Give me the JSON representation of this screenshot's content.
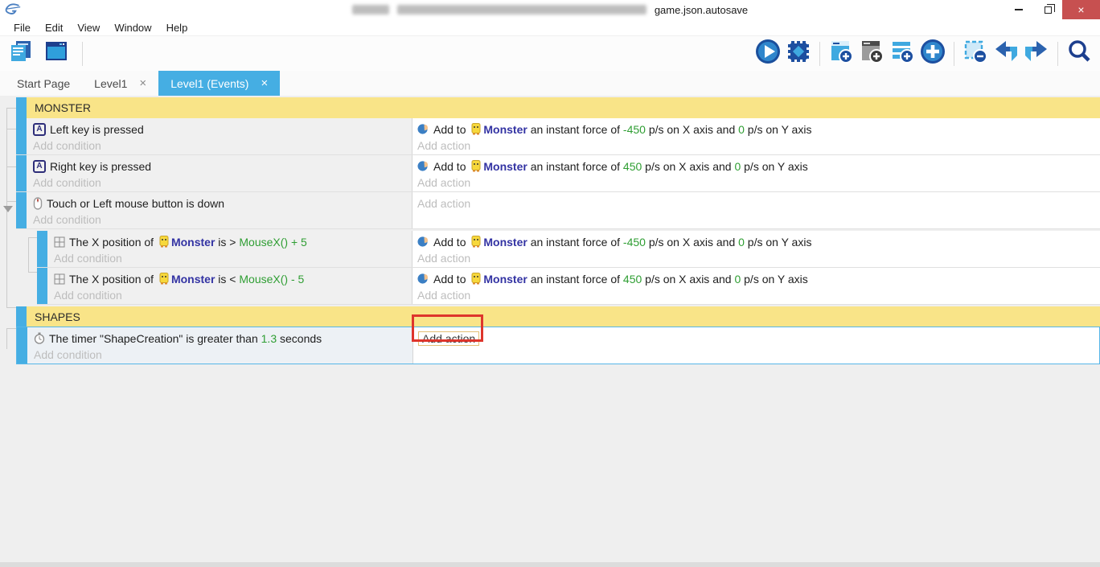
{
  "titlebar": {
    "title_tail": "game.json.autosave",
    "controls": {
      "minimize": "minimize",
      "restore": "restore",
      "close": "×"
    }
  },
  "menubar": {
    "items": [
      "File",
      "Edit",
      "View",
      "Window",
      "Help"
    ]
  },
  "toolbar": {
    "left_icons": [
      "project-manager",
      "scene-editor-window"
    ],
    "right_icons": [
      "play",
      "debug",
      "add-event",
      "add-subevent",
      "add-comment",
      "add-new",
      "remove-selection",
      "undo",
      "redo",
      "search"
    ]
  },
  "tabs": {
    "close_glyph": "×",
    "items": [
      {
        "label": "Start Page"
      },
      {
        "label": "Level1"
      },
      {
        "label": "Level1 (Events)"
      }
    ]
  },
  "sheet": {
    "placeholders": {
      "condition": "Add condition",
      "action": "Add action"
    },
    "key_icon_letter": "A",
    "groups": [
      {
        "label": "MONSTER"
      },
      {
        "label": "SHAPES"
      }
    ],
    "rows": {
      "r1": {
        "cond": {
          "icon": "keyboard-key-icon",
          "text": "Left key is pressed"
        },
        "act": {
          "icon": "force-icon",
          "pre": "Add to ",
          "obj_icon": "monster-object-icon",
          "obj": "Monster",
          "t1": " an instant force of ",
          "v1": "-450",
          "t2": " p/s on X axis and ",
          "v2": "0",
          "t3": " p/s on Y axis"
        }
      },
      "r2": {
        "cond": {
          "icon": "keyboard-key-icon",
          "text": "Right key is pressed"
        },
        "act": {
          "icon": "force-icon",
          "pre": "Add to ",
          "obj_icon": "monster-object-icon",
          "obj": "Monster",
          "t1": " an instant force of ",
          "v1": "450",
          "t2": " p/s on X axis and ",
          "v2": "0",
          "t3": " p/s on Y axis"
        }
      },
      "r3": {
        "cond": {
          "icon": "mouse-icon",
          "text": "Touch or Left mouse button is down"
        }
      },
      "s1": {
        "cond": {
          "icon": "x-position-icon",
          "pre": "The X position of ",
          "obj_icon": "monster-object-icon",
          "obj": "Monster",
          "mid": " is ",
          "op": "> ",
          "expr": "MouseX() + 5"
        },
        "act": {
          "icon": "force-icon",
          "pre": "Add to ",
          "obj_icon": "monster-object-icon",
          "obj": "Monster",
          "t1": " an instant force of ",
          "v1": "-450",
          "t2": " p/s on X axis and ",
          "v2": "0",
          "t3": " p/s on Y axis"
        }
      },
      "s2": {
        "cond": {
          "icon": "x-position-icon",
          "pre": "The X position of ",
          "obj_icon": "monster-object-icon",
          "obj": "Monster",
          "mid": " is ",
          "op": "< ",
          "expr": "MouseX() - 5"
        },
        "act": {
          "icon": "force-icon",
          "pre": "Add to ",
          "obj_icon": "monster-object-icon",
          "obj": "Monster",
          "t1": " an instant force of ",
          "v1": "450",
          "t2": " p/s on X axis and ",
          "v2": "0",
          "t3": " p/s on Y axis"
        }
      },
      "t1": {
        "cond": {
          "icon": "timer-icon",
          "pre": "The timer ",
          "name": "\"ShapeCreation\"",
          "mid": " is greater than ",
          "value": "1.3",
          "tail": " seconds"
        }
      }
    }
  },
  "colors": {
    "accent_blue": "#45aee3",
    "group_yellow": "#f9e488",
    "value_green": "#2f9e33",
    "object_blue": "#3333a3",
    "annotation_red": "#de352c",
    "close_button_red": "#c75050"
  }
}
